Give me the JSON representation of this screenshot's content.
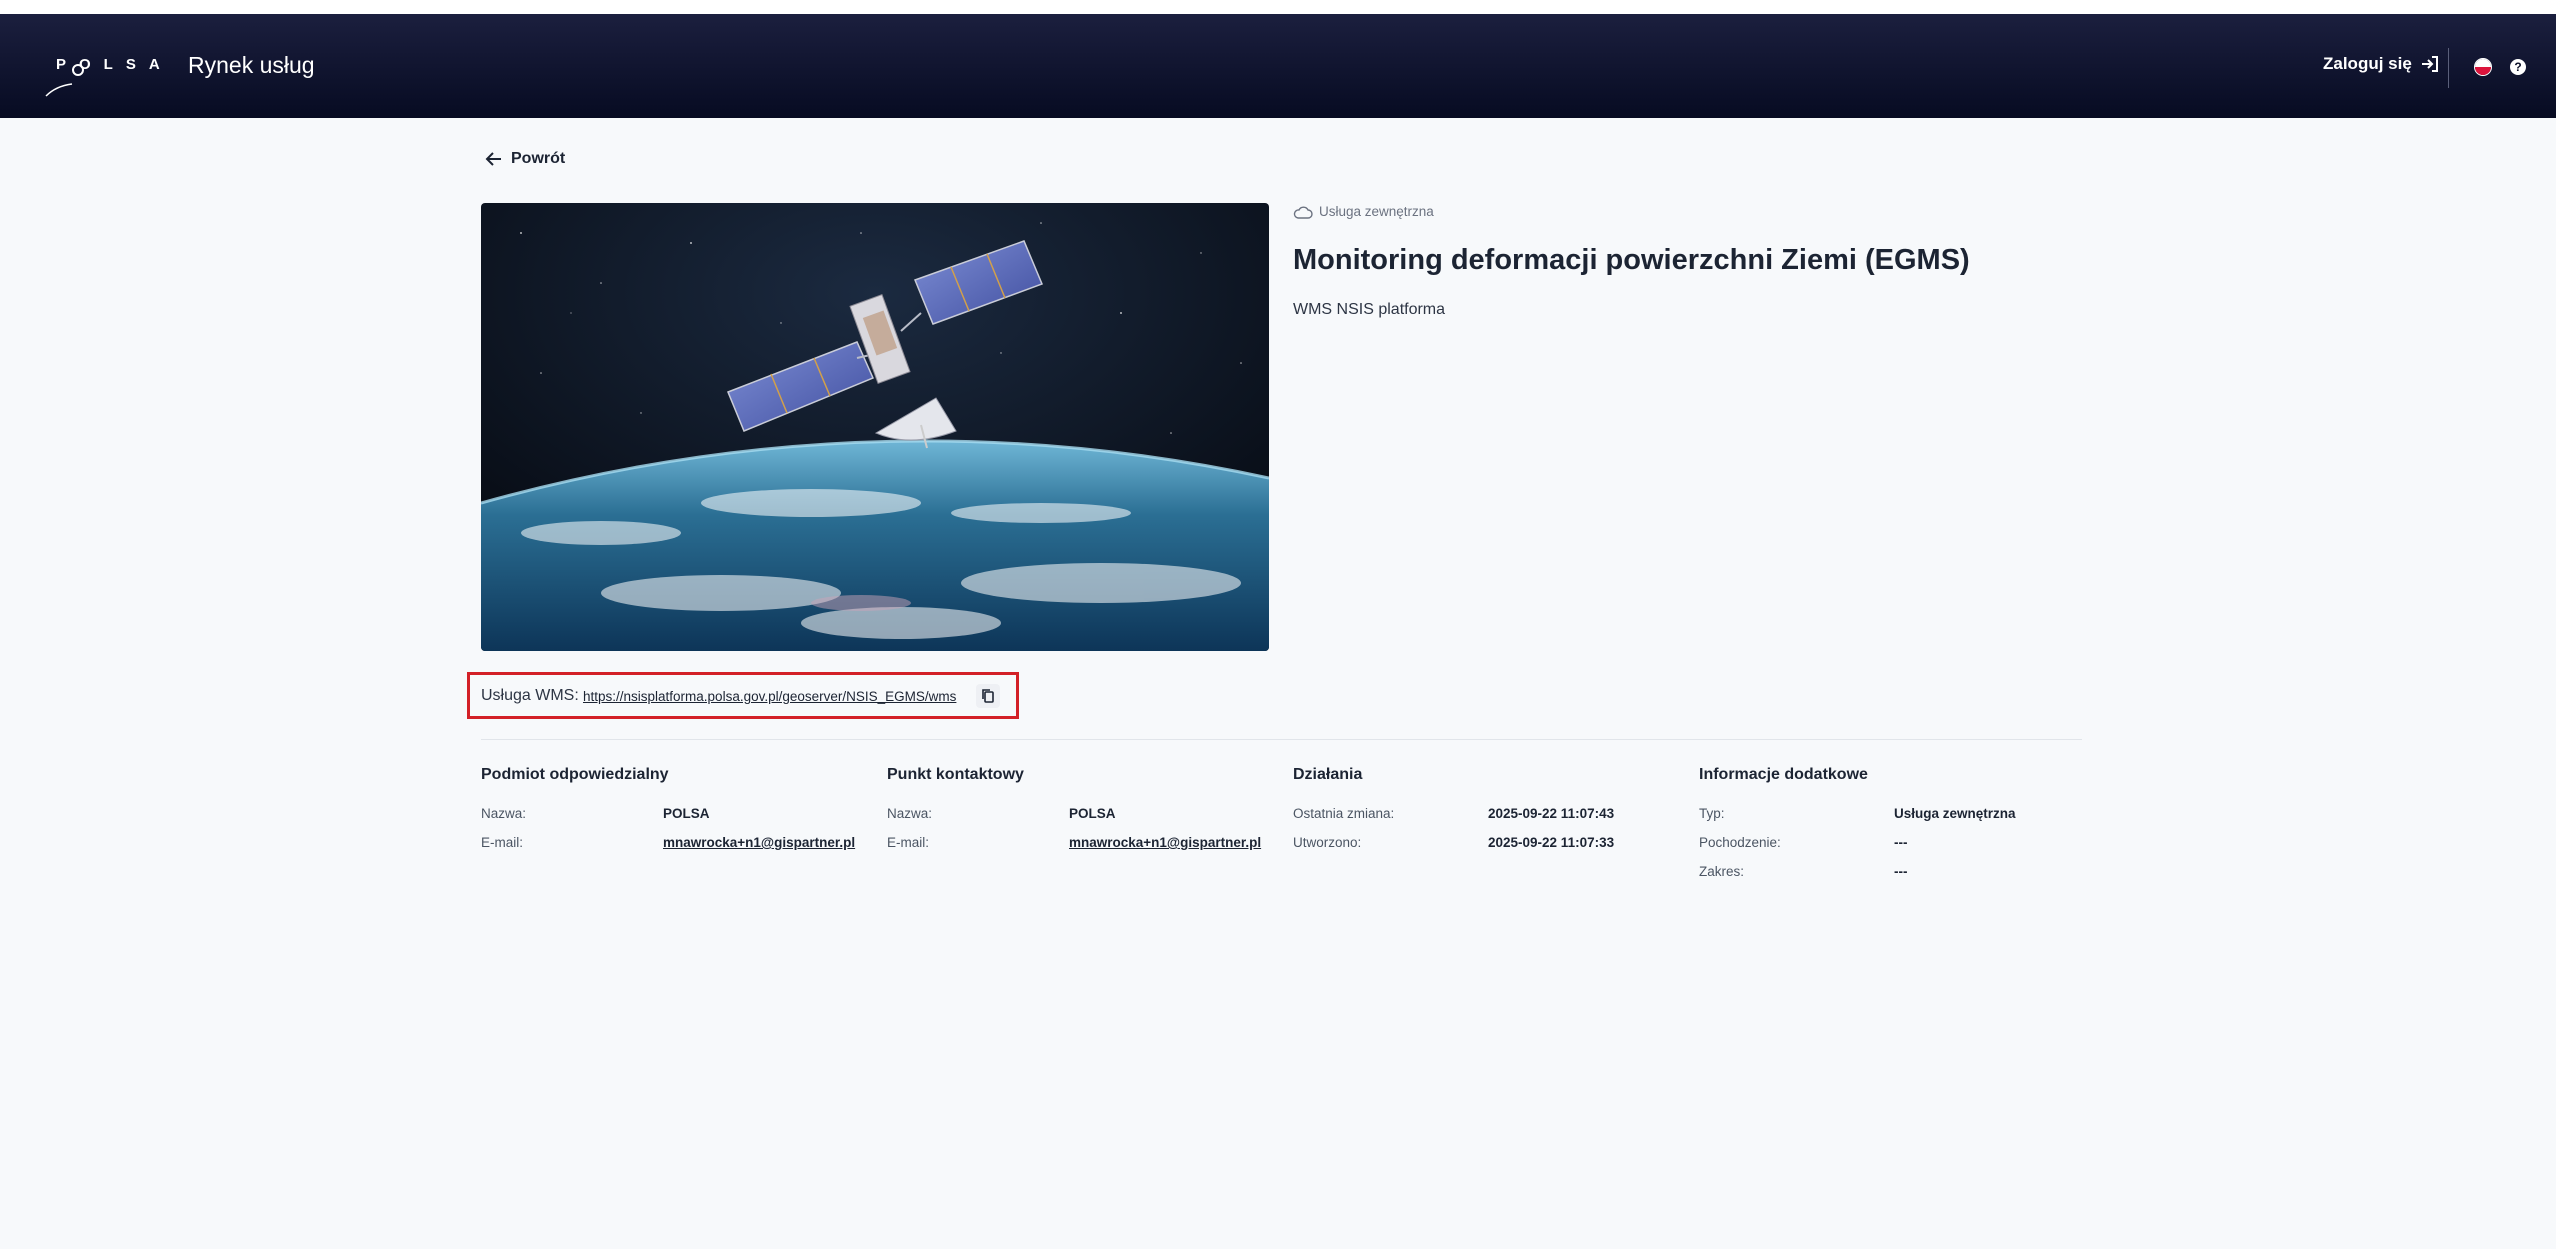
{
  "header": {
    "logo_text": "POLSA",
    "app_title": "Rynek usług",
    "login_label": "Zaloguj się",
    "help_label": "?"
  },
  "nav": {
    "back_label": "Powrót"
  },
  "service": {
    "badge": "Usługa zewnętrzna",
    "title": "Monitoring deformacji powierzchni Ziemi (EGMS)",
    "subtitle": "WMS NSIS platforma",
    "wms_label": "Usługa WMS:",
    "wms_url": "https://nsisplatforma.polsa.gov.pl/geoserver/NSIS_EGMS/wms"
  },
  "sections": [
    {
      "title": "Podmiot odpowiedzialny",
      "rows": [
        {
          "key": "Nazwa:",
          "value": "POLSA"
        },
        {
          "key": "E-mail:",
          "value": "mnawrocka+n1@gispartner.pl"
        }
      ]
    },
    {
      "title": "Punkt kontaktowy",
      "rows": [
        {
          "key": "Nazwa:",
          "value": "POLSA"
        },
        {
          "key": "E-mail:",
          "value": "mnawrocka+n1@gispartner.pl"
        }
      ]
    },
    {
      "title": "Działania",
      "rows": [
        {
          "key": "Ostatnia zmiana:",
          "value": "2025-09-22 11:07:43"
        },
        {
          "key": "Utworzono:",
          "value": "2025-09-22 11:07:33"
        }
      ]
    },
    {
      "title": "Informacje dodatkowe",
      "rows": [
        {
          "key": "Typ:",
          "value": "Usługa zewnętrzna"
        },
        {
          "key": "Pochodzenie:",
          "value": "---"
        },
        {
          "key": "Zakres:",
          "value": "---"
        }
      ]
    }
  ],
  "colors": {
    "header_bg": "#0a0e27",
    "highlight_border": "#d32027",
    "page_bg": "#f7f9fb"
  }
}
